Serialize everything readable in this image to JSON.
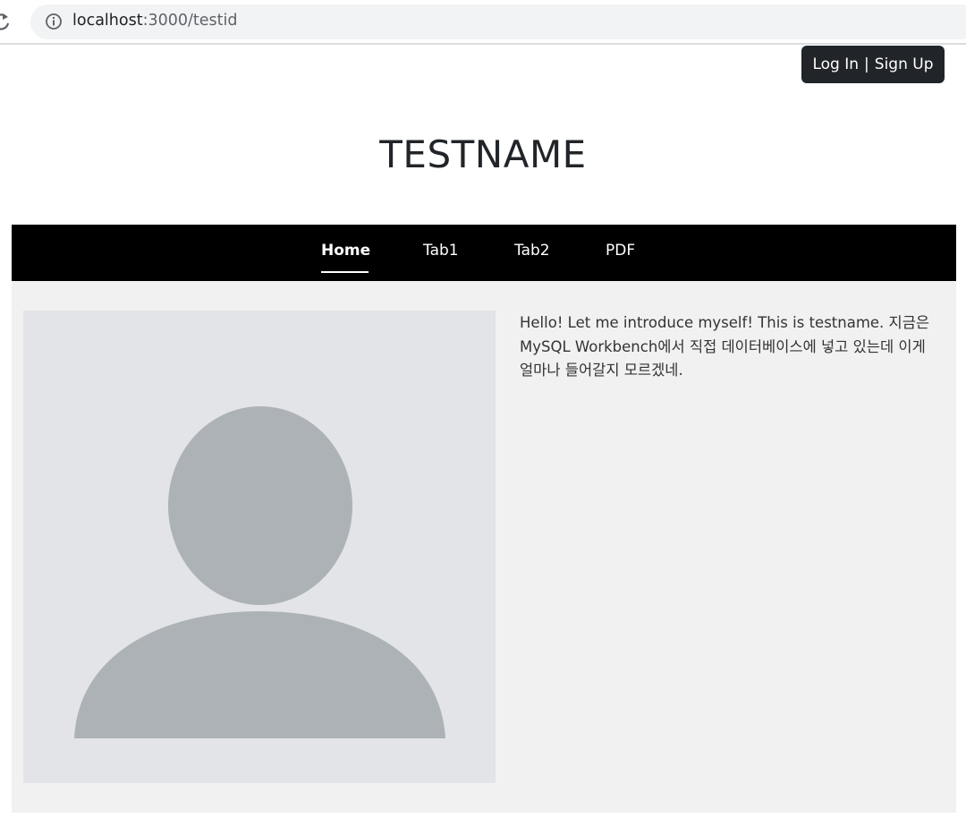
{
  "browser": {
    "url_host": "localhost",
    "url_path": ":3000/testid"
  },
  "auth": {
    "login_label": "Log In",
    "separator": "|",
    "signup_label": "Sign Up"
  },
  "page": {
    "title": "TESTNAME"
  },
  "nav": {
    "items": [
      {
        "label": "Home",
        "active": true
      },
      {
        "label": "Tab1",
        "active": false
      },
      {
        "label": "Tab2",
        "active": false
      },
      {
        "label": "PDF",
        "active": false
      }
    ]
  },
  "profile": {
    "intro": "Hello! Let me introduce myself! This is testname. 지금은 MySQL Workbench에서 직접 데이터베이스에 넣고 있는데 이게 얼마나 들어갈지 모르겠네."
  },
  "colors": {
    "nav_bg": "#000000",
    "button_bg": "#212529",
    "content_bg": "#f1f1f1",
    "avatar_bg": "#e2e4e7",
    "avatar_fg": "#adb2b6"
  }
}
